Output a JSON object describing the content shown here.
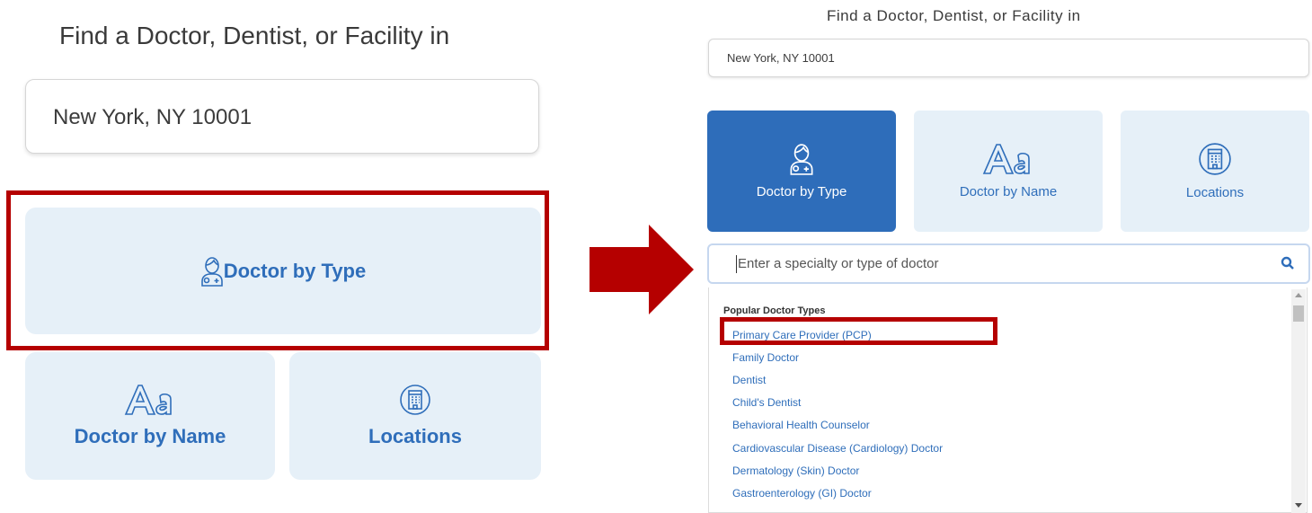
{
  "left": {
    "title": "Find a Doctor, Dentist, or Facility in",
    "location_value": "New York, NY 10001",
    "doctor_by_type_label": "Doctor by Type",
    "doctor_by_name_label": "Doctor by Name",
    "locations_label": "Locations"
  },
  "right": {
    "title": "Find a Doctor, Dentist, or Facility in",
    "location_value": "New York, NY 10001",
    "tiles": {
      "doctor_by_type": "Doctor by Type",
      "doctor_by_name": "Doctor by Name",
      "locations": "Locations"
    },
    "search_placeholder": "Enter a specialty or type of doctor",
    "list_heading": "Popular Doctor Types",
    "list_items": [
      "Primary Care Provider (PCP)",
      "Family Doctor",
      "Dentist",
      "Child's Dentist",
      "Behavioral Health Counselor",
      "Cardiovascular Disease (Cardiology) Doctor",
      "Dermatology (Skin) Doctor",
      "Gastroenterology (GI) Doctor"
    ]
  },
  "icons": {
    "doctor": "doctor-icon",
    "font": "font-aa-icon",
    "building": "building-icon",
    "search": "search-icon",
    "arrow": "right-arrow"
  },
  "colors": {
    "accent": "#2e6dba",
    "tile_bg": "#e6f0f8",
    "highlight": "#b50000"
  }
}
